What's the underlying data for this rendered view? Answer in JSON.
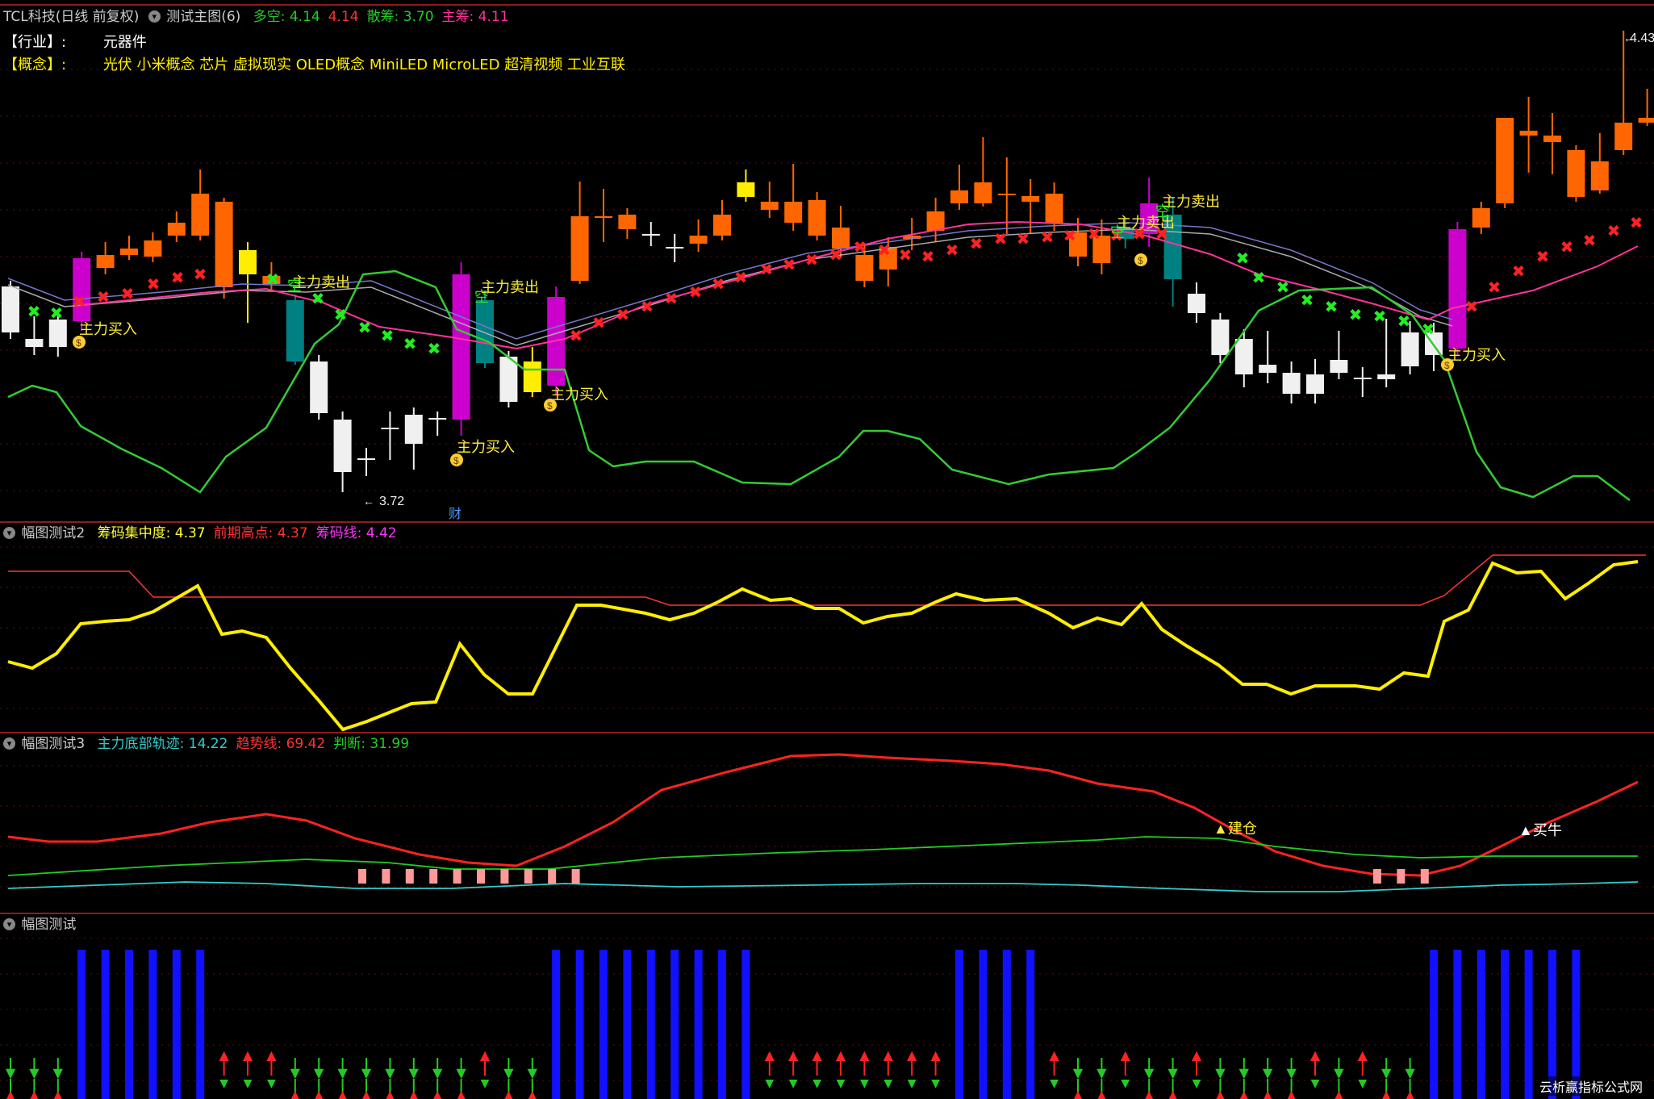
{
  "window": {
    "stock_title": "TCL科技(日线 前复权)",
    "main_indicator": "测试主图(6)",
    "main_values": [
      {
        "label": "多空:",
        "value": "4.14",
        "color": "#22cc22"
      },
      {
        "label": "",
        "value": "4.14",
        "color": "#ff3333"
      },
      {
        "label": "散筹:",
        "value": "3.70",
        "color": "#22cc22"
      },
      {
        "label": "主筹:",
        "value": "4.11",
        "color": "#ff3399"
      }
    ]
  },
  "info": {
    "industry_label": "【行业】:",
    "industry_value": "元器件",
    "concept_label": "【概念】:",
    "concept_value": "光伏 小米概念 芯片 虚拟现实 OLED概念 MiniLED MicroLED 超清视频 工业互联"
  },
  "annotations": {
    "price_high": "4.43",
    "price_low": "3.72",
    "cai": "财",
    "buy": "主力买入",
    "sell": "主力卖出",
    "trend_buy": "主力买入",
    "kong": "空",
    "jian_cang": "▲建仓",
    "mai_niu": "▲买牛"
  },
  "pane2": {
    "title": "幅图测试2",
    "values": [
      {
        "label": "筹码集中度:",
        "value": "4.37",
        "color": "#ffff33"
      },
      {
        "label": "前期高点:",
        "value": "4.37",
        "color": "#ff3333"
      },
      {
        "label": "筹码线:",
        "value": "4.42",
        "color": "#ff33ff"
      }
    ]
  },
  "pane3": {
    "title": "幅图测试3",
    "values": [
      {
        "label": "主力底部轨迹:",
        "value": "14.22",
        "color": "#33cccc"
      },
      {
        "label": "趋势线:",
        "value": "69.42",
        "color": "#ff3333"
      },
      {
        "label": "判断:",
        "value": "31.99",
        "color": "#22cc22"
      }
    ]
  },
  "pane4": {
    "title": "幅图测试"
  },
  "watermark": "云析赢指标公式网",
  "colors": {
    "up": "#ff6600",
    "down_white": "#f0f0f0",
    "teal": "#008080",
    "magenta": "#cc00cc",
    "yellow": "#ffee00",
    "green_line": "#33cc33",
    "pink_line": "#ff3399",
    "blue_bar": "#1111ff",
    "separator": "#8c1d1d"
  }
}
